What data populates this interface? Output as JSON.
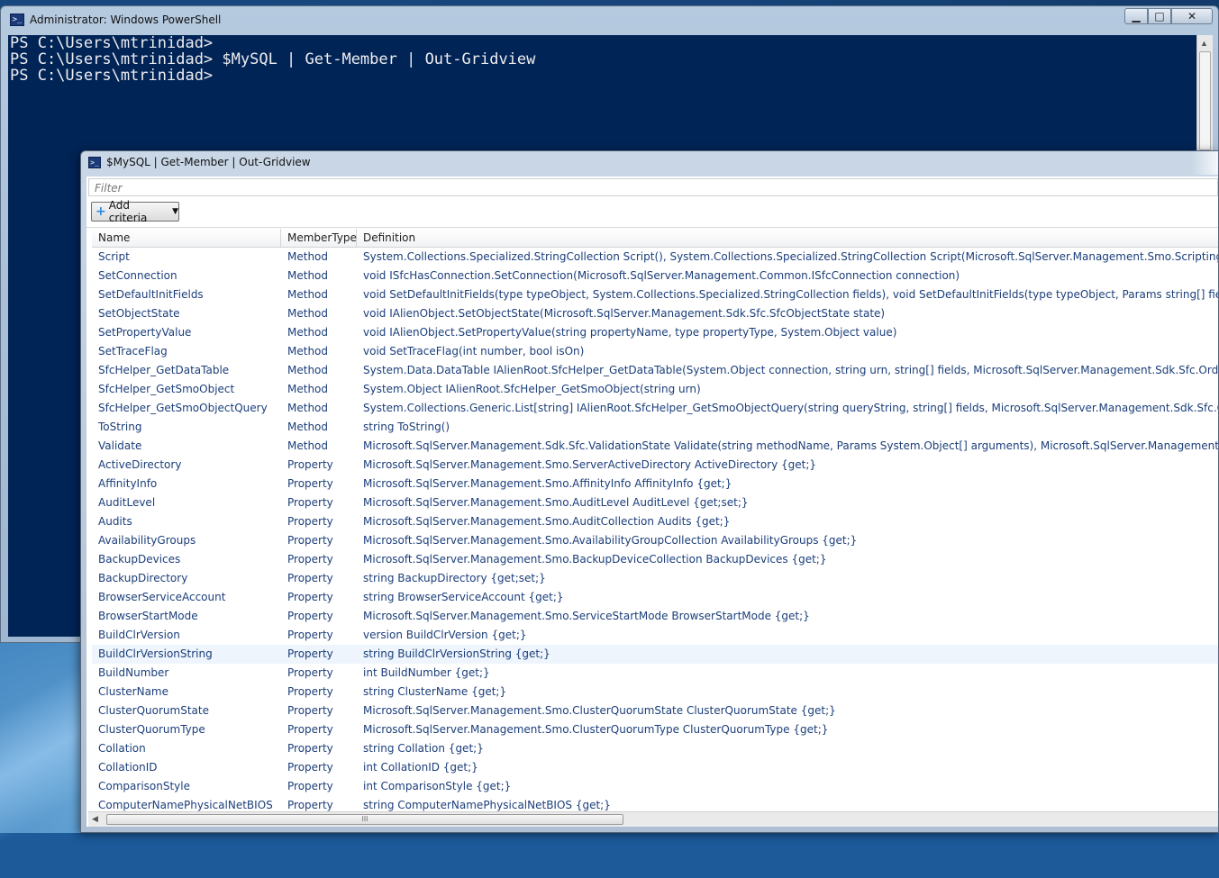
{
  "ps_window": {
    "title": "Administrator: Windows PowerShell",
    "caption": {
      "minimize": "▁",
      "maximize": "□",
      "close": "✕"
    },
    "lines": [
      "PS C:\\Users\\mtrinidad>",
      "PS C:\\Users\\mtrinidad> $MySQL | Get-Member | Out-Gridview",
      "PS C:\\Users\\mtrinidad>"
    ],
    "colors": {
      "background": "#012456",
      "text": "#eeedf0"
    }
  },
  "gridview": {
    "title": "$MySQL | Get-Member | Out-Gridview",
    "filter_placeholder": "Filter",
    "add_criteria_label": "Add criteria",
    "columns": {
      "name": "Name",
      "type": "MemberType",
      "definition": "Definition"
    },
    "link_color": "#1b3e7a",
    "rows": [
      {
        "name": "Script",
        "type": "Method",
        "def": "System.Collections.Specialized.StringCollection Script(), System.Collections.Specialized.StringCollection Script(Microsoft.SqlServer.Management.Smo.ScriptingOptions scriptingOptio"
      },
      {
        "name": "SetConnection",
        "type": "Method",
        "def": "void ISfcHasConnection.SetConnection(Microsoft.SqlServer.Management.Common.ISfcConnection connection)"
      },
      {
        "name": "SetDefaultInitFields",
        "type": "Method",
        "def": "void SetDefaultInitFields(type typeObject, System.Collections.Specialized.StringCollection fields), void SetDefaultInitFields(type typeObject, Params string[] fields), void SetDefaultInit"
      },
      {
        "name": "SetObjectState",
        "type": "Method",
        "def": "void IAlienObject.SetObjectState(Microsoft.SqlServer.Management.Sdk.Sfc.SfcObjectState state)"
      },
      {
        "name": "SetPropertyValue",
        "type": "Method",
        "def": "void IAlienObject.SetPropertyValue(string propertyName, type propertyType, System.Object value)"
      },
      {
        "name": "SetTraceFlag",
        "type": "Method",
        "def": "void SetTraceFlag(int number, bool isOn)"
      },
      {
        "name": "SfcHelper_GetDataTable",
        "type": "Method",
        "def": "System.Data.DataTable IAlienRoot.SfcHelper_GetDataTable(System.Object connection, string urn, string[] fields, Microsoft.SqlServer.Management.Sdk.Sfc.OrderBy[] orderByFields)"
      },
      {
        "name": "SfcHelper_GetSmoObject",
        "type": "Method",
        "def": "System.Object IAlienRoot.SfcHelper_GetSmoObject(string urn)"
      },
      {
        "name": "SfcHelper_GetSmoObjectQuery",
        "type": "Method",
        "def": "System.Collections.Generic.List[string] IAlienRoot.SfcHelper_GetSmoObjectQuery(string queryString, string[] fields, Microsoft.SqlServer.Management.Sdk.Sfc.OrderBy[] orderByFields)"
      },
      {
        "name": "ToString",
        "type": "Method",
        "def": "string ToString()"
      },
      {
        "name": "Validate",
        "type": "Method",
        "def": "Microsoft.SqlServer.Management.Sdk.Sfc.ValidationState Validate(string methodName, Params System.Object[] arguments), Microsoft.SqlServer.Management.Sdk.Sfc.ValidationState"
      },
      {
        "name": "ActiveDirectory",
        "type": "Property",
        "def": "Microsoft.SqlServer.Management.Smo.ServerActiveDirectory ActiveDirectory {get;}"
      },
      {
        "name": "AffinityInfo",
        "type": "Property",
        "def": "Microsoft.SqlServer.Management.Smo.AffinityInfo AffinityInfo {get;}"
      },
      {
        "name": "AuditLevel",
        "type": "Property",
        "def": "Microsoft.SqlServer.Management.Smo.AuditLevel AuditLevel {get;set;}"
      },
      {
        "name": "Audits",
        "type": "Property",
        "def": "Microsoft.SqlServer.Management.Smo.AuditCollection Audits {get;}"
      },
      {
        "name": "AvailabilityGroups",
        "type": "Property",
        "def": "Microsoft.SqlServer.Management.Smo.AvailabilityGroupCollection AvailabilityGroups {get;}"
      },
      {
        "name": "BackupDevices",
        "type": "Property",
        "def": "Microsoft.SqlServer.Management.Smo.BackupDeviceCollection BackupDevices {get;}"
      },
      {
        "name": "BackupDirectory",
        "type": "Property",
        "def": "string BackupDirectory {get;set;}"
      },
      {
        "name": "BrowserServiceAccount",
        "type": "Property",
        "def": "string BrowserServiceAccount {get;}"
      },
      {
        "name": "BrowserStartMode",
        "type": "Property",
        "def": "Microsoft.SqlServer.Management.Smo.ServiceStartMode BrowserStartMode {get;}"
      },
      {
        "name": "BuildClrVersion",
        "type": "Property",
        "def": "version BuildClrVersion {get;}"
      },
      {
        "name": "BuildClrVersionString",
        "type": "Property",
        "def": "string BuildClrVersionString {get;}",
        "highlight": true
      },
      {
        "name": "BuildNumber",
        "type": "Property",
        "def": "int BuildNumber {get;}"
      },
      {
        "name": "ClusterName",
        "type": "Property",
        "def": "string ClusterName {get;}"
      },
      {
        "name": "ClusterQuorumState",
        "type": "Property",
        "def": "Microsoft.SqlServer.Management.Smo.ClusterQuorumState ClusterQuorumState {get;}"
      },
      {
        "name": "ClusterQuorumType",
        "type": "Property",
        "def": "Microsoft.SqlServer.Management.Smo.ClusterQuorumType ClusterQuorumType {get;}"
      },
      {
        "name": "Collation",
        "type": "Property",
        "def": "string Collation {get;}"
      },
      {
        "name": "CollationID",
        "type": "Property",
        "def": "int CollationID {get;}"
      },
      {
        "name": "ComparisonStyle",
        "type": "Property",
        "def": "int ComparisonStyle {get;}"
      },
      {
        "name": "ComputerNamePhysicalNetBIOS",
        "type": "Property",
        "def": "string ComputerNamePhysicalNetBIOS {get;}"
      }
    ],
    "scroll_grip": "III"
  }
}
